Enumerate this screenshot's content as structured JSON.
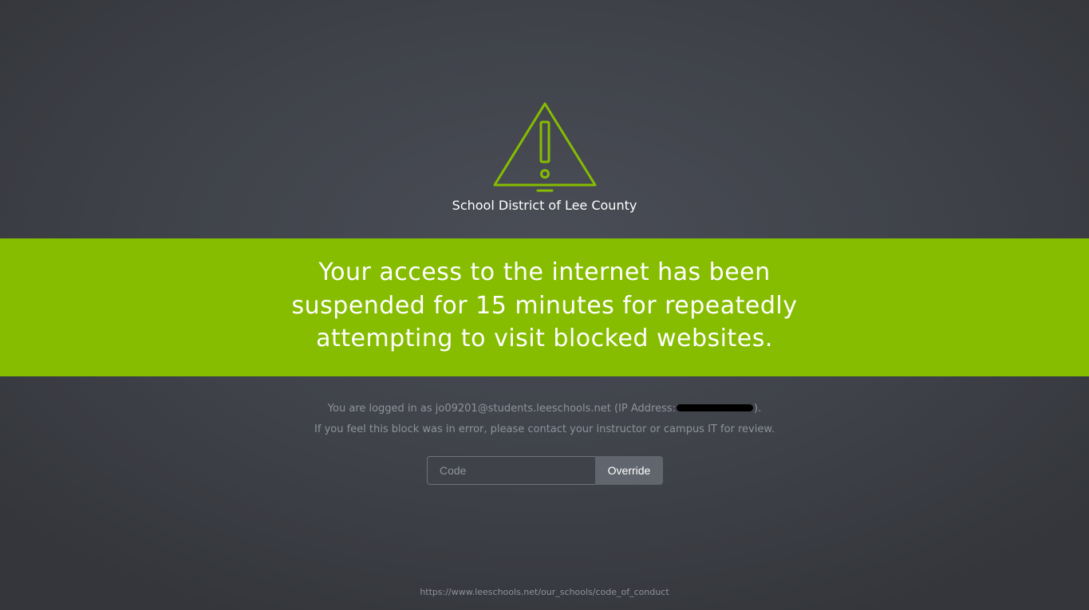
{
  "header": {
    "icon": "warning-triangle-icon",
    "org_name": "School District of Lee County"
  },
  "banner": {
    "message": "Your access to the internet has been suspended for 15 minutes for repeatedly attempting to visit blocked websites.",
    "color": "#86bd00"
  },
  "info": {
    "login_prefix": "You are logged in as jo09201@students.leeschools.net (IP Address:",
    "login_suffix": ").",
    "error_text": "If you feel this block was in error, please contact your instructor or campus IT for review."
  },
  "override": {
    "code_placeholder": "Code",
    "code_value": "",
    "button_label": "Override"
  },
  "footer": {
    "link_text": "https://www.leeschools.net/our_schools/code_of_conduct"
  },
  "colors": {
    "accent": "#86bd00",
    "background": "#3f4249",
    "muted_text": "#8e929b"
  }
}
